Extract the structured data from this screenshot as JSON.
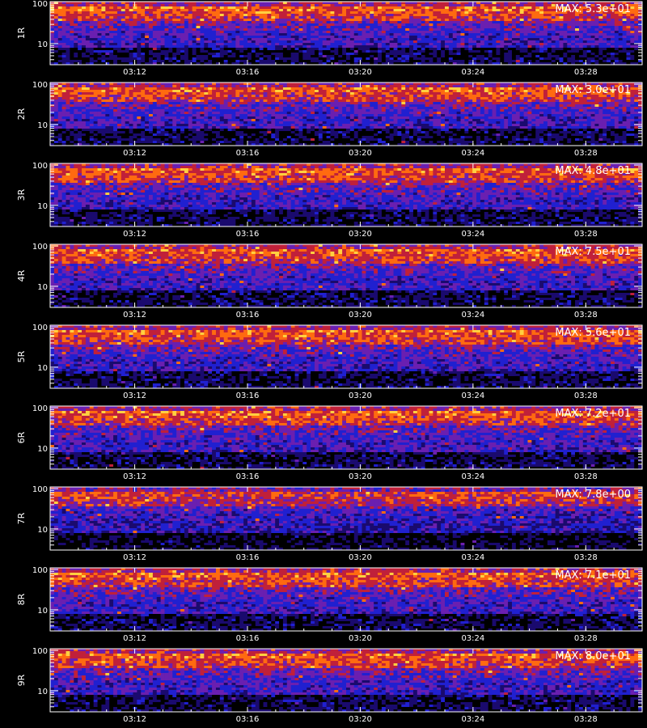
{
  "chart_data": {
    "type": "heatmap",
    "y_scale": "log",
    "ylim": [
      3,
      110
    ],
    "y_ticks": [
      {
        "value": 10,
        "label": "10"
      },
      {
        "value": 100,
        "label": "100"
      }
    ],
    "x_range": [
      "03:09:00",
      "03:30:00"
    ],
    "x_ticks": [
      "03:12",
      "03:16",
      "03:20",
      "03:24",
      "03:28"
    ],
    "panels": [
      {
        "ylabel": "1R",
        "max_label": "MAX: 5.3e+01",
        "max": 53
      },
      {
        "ylabel": "2R",
        "max_label": "MAX: 3.0e+01",
        "max": 30
      },
      {
        "ylabel": "3R",
        "max_label": "MAX: 4.8e+01",
        "max": 48
      },
      {
        "ylabel": "4R",
        "max_label": "MAX: 7.5e+01",
        "max": 75
      },
      {
        "ylabel": "5R",
        "max_label": "MAX: 5.6e+01",
        "max": 56
      },
      {
        "ylabel": "6R",
        "max_label": "MAX: 7.2e+01",
        "max": 72
      },
      {
        "ylabel": "7R",
        "max_label": "MAX: 7.8e+00",
        "max": 7.8
      },
      {
        "ylabel": "8R",
        "max_label": "MAX: 7.1e+01",
        "max": 71
      },
      {
        "ylabel": "9R",
        "max_label": "MAX: 8.0e+01",
        "max": 80
      }
    ],
    "colormap": [
      "#000000",
      "#1a0a6e",
      "#2020d0",
      "#6a1fb0",
      "#c0203a",
      "#ff6a10",
      "#ffd040"
    ]
  }
}
